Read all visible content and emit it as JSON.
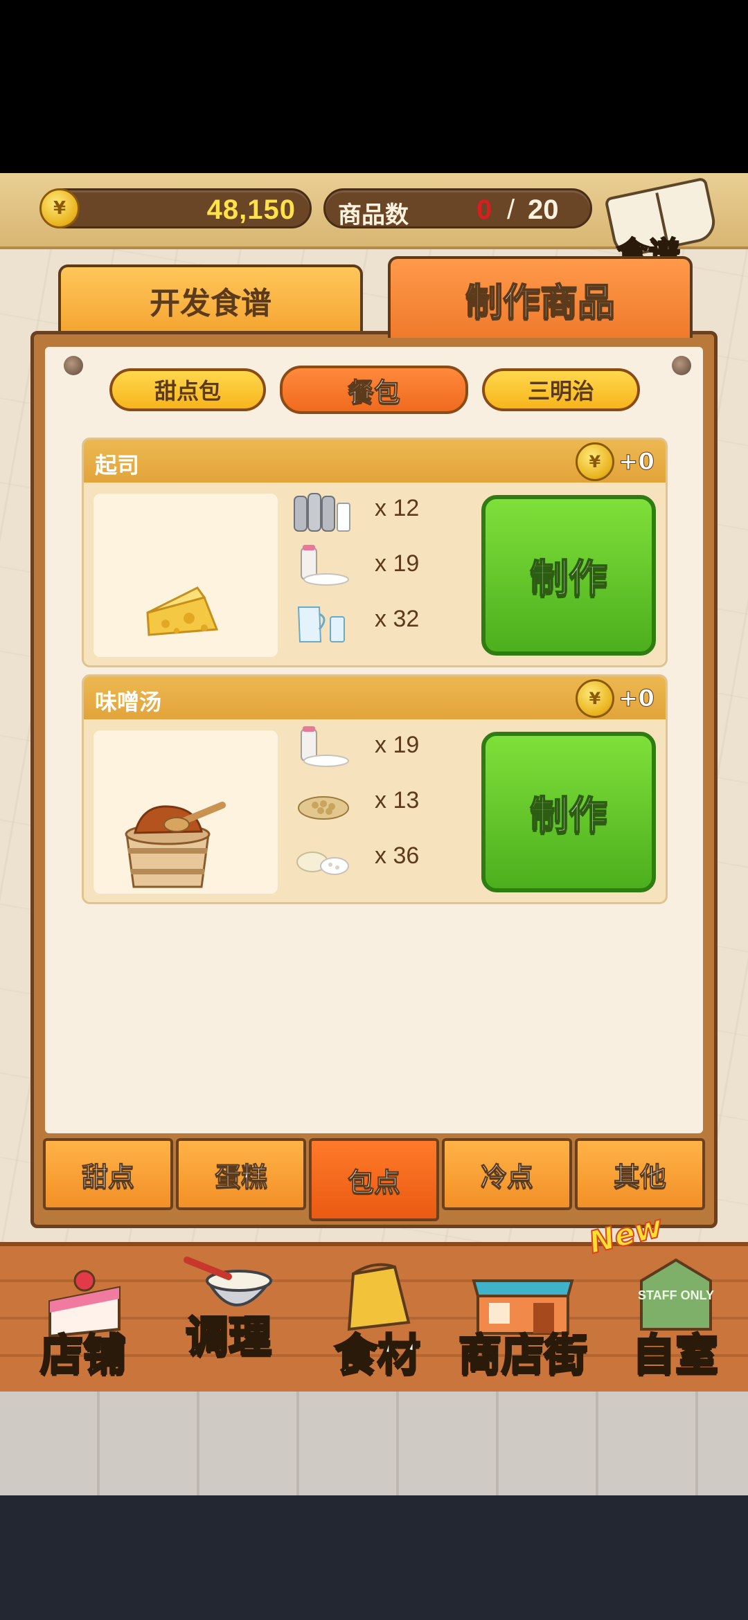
{
  "header": {
    "money": "48,150",
    "currency_symbol": "¥",
    "product_count_label": "商品数",
    "product_count_current": "0",
    "product_count_separator": "/",
    "product_count_max": "20",
    "recipe_book_label": "食谱"
  },
  "main_tabs": [
    {
      "label": "开发食谱",
      "active": false
    },
    {
      "label": "制作商品",
      "active": true
    }
  ],
  "sub_tabs": [
    {
      "label": "甜点包",
      "active": false
    },
    {
      "label": "餐包",
      "active": true
    },
    {
      "label": "三明治",
      "active": false
    }
  ],
  "recipes": [
    {
      "name": "起司",
      "reward": "+0",
      "image_icon": "cheese-icon",
      "ingredients": [
        {
          "icon": "milk-bottles-icon",
          "qty": "x 12"
        },
        {
          "icon": "sugar-bag-icon",
          "qty": "x 19"
        },
        {
          "icon": "water-jug-icon",
          "qty": "x 32"
        }
      ],
      "button_label": "制作"
    },
    {
      "name": "味噌汤",
      "reward": "+0",
      "image_icon": "miso-bucket-icon",
      "ingredients": [
        {
          "icon": "sugar-bag-icon",
          "qty": "x 19"
        },
        {
          "icon": "soybeans-icon",
          "qty": "x 13"
        },
        {
          "icon": "salt-pile-icon",
          "qty": "x 36"
        }
      ],
      "button_label": "制作"
    }
  ],
  "category_tabs": [
    {
      "label": "甜点",
      "active": false
    },
    {
      "label": "蛋糕",
      "active": false
    },
    {
      "label": "包点",
      "active": true
    },
    {
      "label": "冷点",
      "active": false
    },
    {
      "label": "其他",
      "active": false
    }
  ],
  "bottom_nav": [
    {
      "label": "店铺",
      "icon": "cake-icon"
    },
    {
      "label": "调理",
      "icon": "mixing-bowl-icon"
    },
    {
      "label": "食材",
      "icon": "flour-sack-icon"
    },
    {
      "label": "商店街",
      "icon": "storefront-icon"
    },
    {
      "label": "自室",
      "icon": "staff-door-icon",
      "badge": "New",
      "sign_text": "STAFF ONLY"
    }
  ],
  "colors": {
    "make_button": "#5cc224",
    "active_tab": "#f07a2c",
    "money_text": "#ffe24a",
    "count_current": "#d81e1e"
  }
}
